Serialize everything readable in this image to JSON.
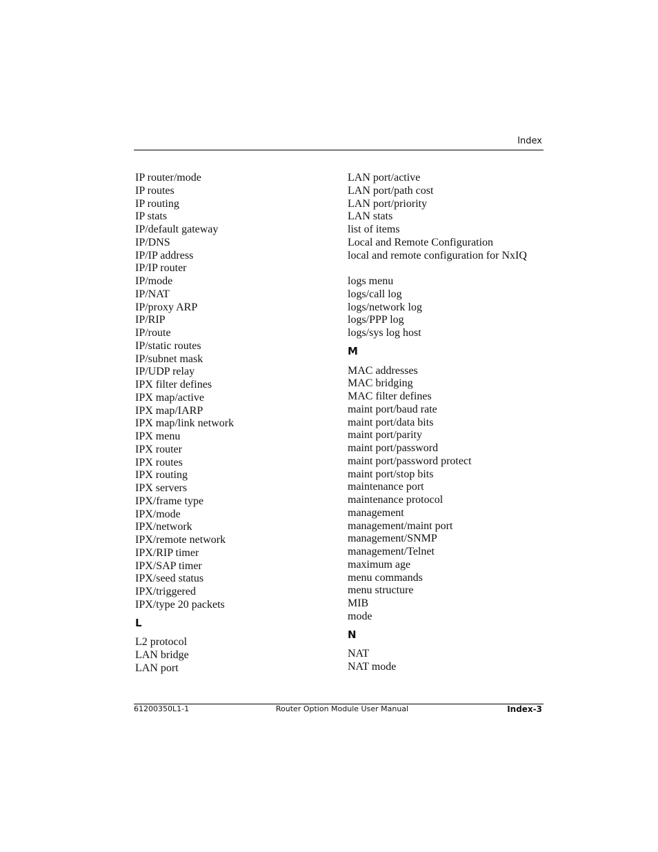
{
  "header": {
    "running_title": "Index"
  },
  "columns": {
    "left": {
      "entries_a": [
        "IP router/mode",
        "IP routes",
        "IP routing",
        "IP stats",
        "IP/default gateway",
        "IP/DNS",
        "IP/IP address",
        "IP/IP router",
        "IP/mode",
        "IP/NAT",
        "IP/proxy ARP",
        "IP/RIP",
        "IP/route",
        "IP/static routes",
        "IP/subnet mask",
        "IP/UDP relay",
        "IPX filter defines",
        "IPX map/active",
        "IPX map/IARP",
        "IPX map/link network",
        "IPX menu",
        "IPX router",
        "IPX routes",
        "IPX routing",
        "IPX servers",
        "IPX/frame type",
        "IPX/mode",
        "IPX/network",
        "IPX/remote network",
        "IPX/RIP timer",
        "IPX/SAP timer",
        "IPX/seed status",
        "IPX/triggered",
        "IPX/type 20 packets"
      ],
      "section_L": "L",
      "entries_L": [
        "L2 protocol",
        "LAN bridge",
        "LAN port"
      ]
    },
    "right": {
      "entries_a": [
        "LAN port/active",
        "LAN port/path cost",
        "LAN port/priority",
        "LAN stats",
        "list of items",
        "Local and Remote Configuration",
        "local and remote configuration for NxIQ"
      ],
      "entries_b": [
        "logs menu",
        "logs/call log",
        "logs/network log",
        "logs/PPP log",
        "logs/sys log host"
      ],
      "section_M": "M",
      "entries_M": [
        "MAC addresses",
        "MAC bridging",
        "MAC filter defines",
        "maint port/baud rate",
        "maint port/data bits",
        "maint port/parity",
        "maint port/password",
        "maint port/password protect",
        "maint port/stop bits",
        "maintenance port",
        "maintenance protocol",
        "management",
        "management/maint port",
        "management/SNMP",
        "management/Telnet",
        "maximum age",
        "menu commands",
        "menu structure",
        "MIB",
        "mode"
      ],
      "section_N": "N",
      "entries_N": [
        "NAT",
        "NAT mode"
      ]
    }
  },
  "footer": {
    "doc_number": "61200350L1-1",
    "manual_title": "Router Option Module User Manual",
    "page_number": "Index-3"
  }
}
